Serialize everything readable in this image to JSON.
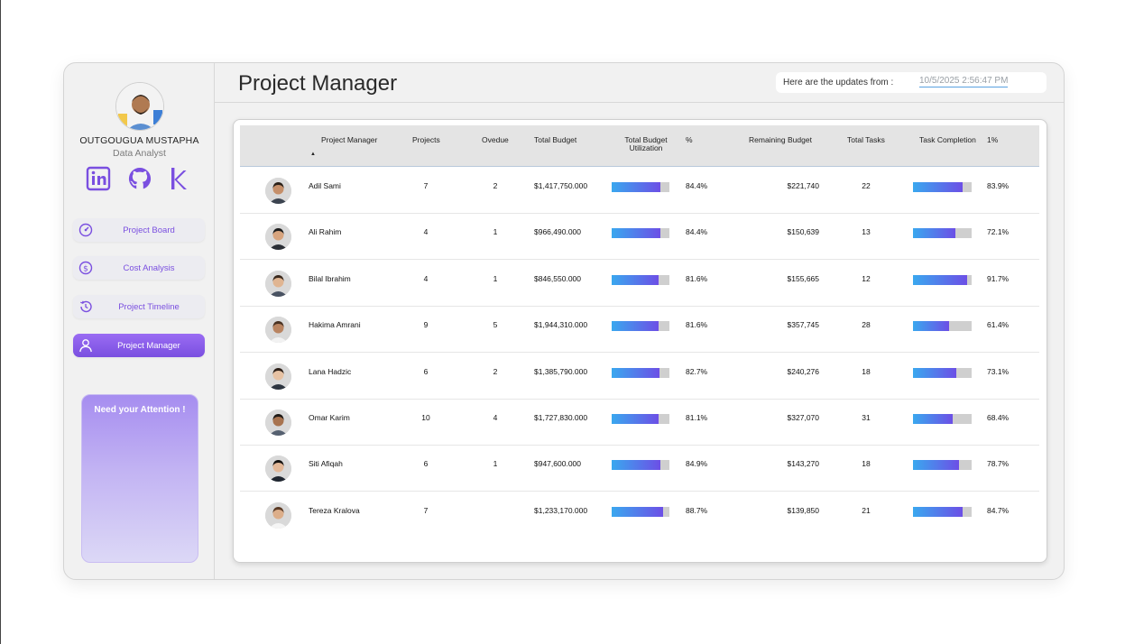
{
  "profile": {
    "name": "OUTGOUGUA MUSTAPHA",
    "role": "Data Analyst",
    "social_icons": [
      "linkedin-icon",
      "github-icon",
      "kaggle-icon"
    ]
  },
  "nav": [
    {
      "label": "Project Board",
      "icon": "gauge-icon",
      "active": false
    },
    {
      "label": "Cost Analysis",
      "icon": "dollar-icon",
      "active": false
    },
    {
      "label": "Project Timeline",
      "icon": "history-icon",
      "active": false
    },
    {
      "label": "Project Manager",
      "icon": "person-icon",
      "active": true
    }
  ],
  "attention": {
    "title": "Need your Attention !"
  },
  "header": {
    "title": "Project Manager",
    "update_label": "Here are the updates from :",
    "update_value": "10/5/2025 2:56:47 PM"
  },
  "colors": {
    "accent": "#7a4fe0",
    "bar_start": "#3aa8ef",
    "bar_end": "#6c4fe6",
    "bar_track": "#cfcfcf"
  },
  "table": {
    "columns": {
      "manager": "Project Manager",
      "projects": "Projects",
      "overdue": "Ovedue",
      "total_budget": "Total Budget",
      "utilization_line1": "Total Budget",
      "utilization_line2": "Utilization",
      "pct": "%",
      "remaining": "Remaining Budget",
      "tasks": "Total Tasks",
      "completion": "Task Completion",
      "pct2": "1%"
    },
    "rows": [
      {
        "name": "Adil Sami",
        "projects": "7",
        "overdue": "2",
        "budget": "$1,417,750.000",
        "util": 84.4,
        "util_text": "84.4%",
        "remaining": "$221,740",
        "tasks": "22",
        "completion": 83.9,
        "completion_text": "83.9%"
      },
      {
        "name": "Ali Rahim",
        "projects": "4",
        "overdue": "1",
        "budget": "$966,490.000",
        "util": 84.4,
        "util_text": "84.4%",
        "remaining": "$150,639",
        "tasks": "13",
        "completion": 72.1,
        "completion_text": "72.1%"
      },
      {
        "name": "Bilal Ibrahim",
        "projects": "4",
        "overdue": "1",
        "budget": "$846,550.000",
        "util": 81.6,
        "util_text": "81.6%",
        "remaining": "$155,665",
        "tasks": "12",
        "completion": 91.7,
        "completion_text": "91.7%"
      },
      {
        "name": "Hakima Amrani",
        "projects": "9",
        "overdue": "5",
        "budget": "$1,944,310.000",
        "util": 81.6,
        "util_text": "81.6%",
        "remaining": "$357,745",
        "tasks": "28",
        "completion": 61.4,
        "completion_text": "61.4%"
      },
      {
        "name": "Lana Hadzic",
        "projects": "6",
        "overdue": "2",
        "budget": "$1,385,790.000",
        "util": 82.7,
        "util_text": "82.7%",
        "remaining": "$240,276",
        "tasks": "18",
        "completion": 73.1,
        "completion_text": "73.1%"
      },
      {
        "name": "Omar Karim",
        "projects": "10",
        "overdue": "4",
        "budget": "$1,727,830.000",
        "util": 81.1,
        "util_text": "81.1%",
        "remaining": "$327,070",
        "tasks": "31",
        "completion": 68.4,
        "completion_text": "68.4%"
      },
      {
        "name": "Siti Afiqah",
        "projects": "6",
        "overdue": "1",
        "budget": "$947,600.000",
        "util": 84.9,
        "util_text": "84.9%",
        "remaining": "$143,270",
        "tasks": "18",
        "completion": 78.7,
        "completion_text": "78.7%"
      },
      {
        "name": "Tereza Kralova",
        "projects": "7",
        "overdue": "",
        "budget": "$1,233,170.000",
        "util": 88.7,
        "util_text": "88.7%",
        "remaining": "$139,850",
        "tasks": "21",
        "completion": 84.7,
        "completion_text": "84.7%"
      }
    ]
  }
}
